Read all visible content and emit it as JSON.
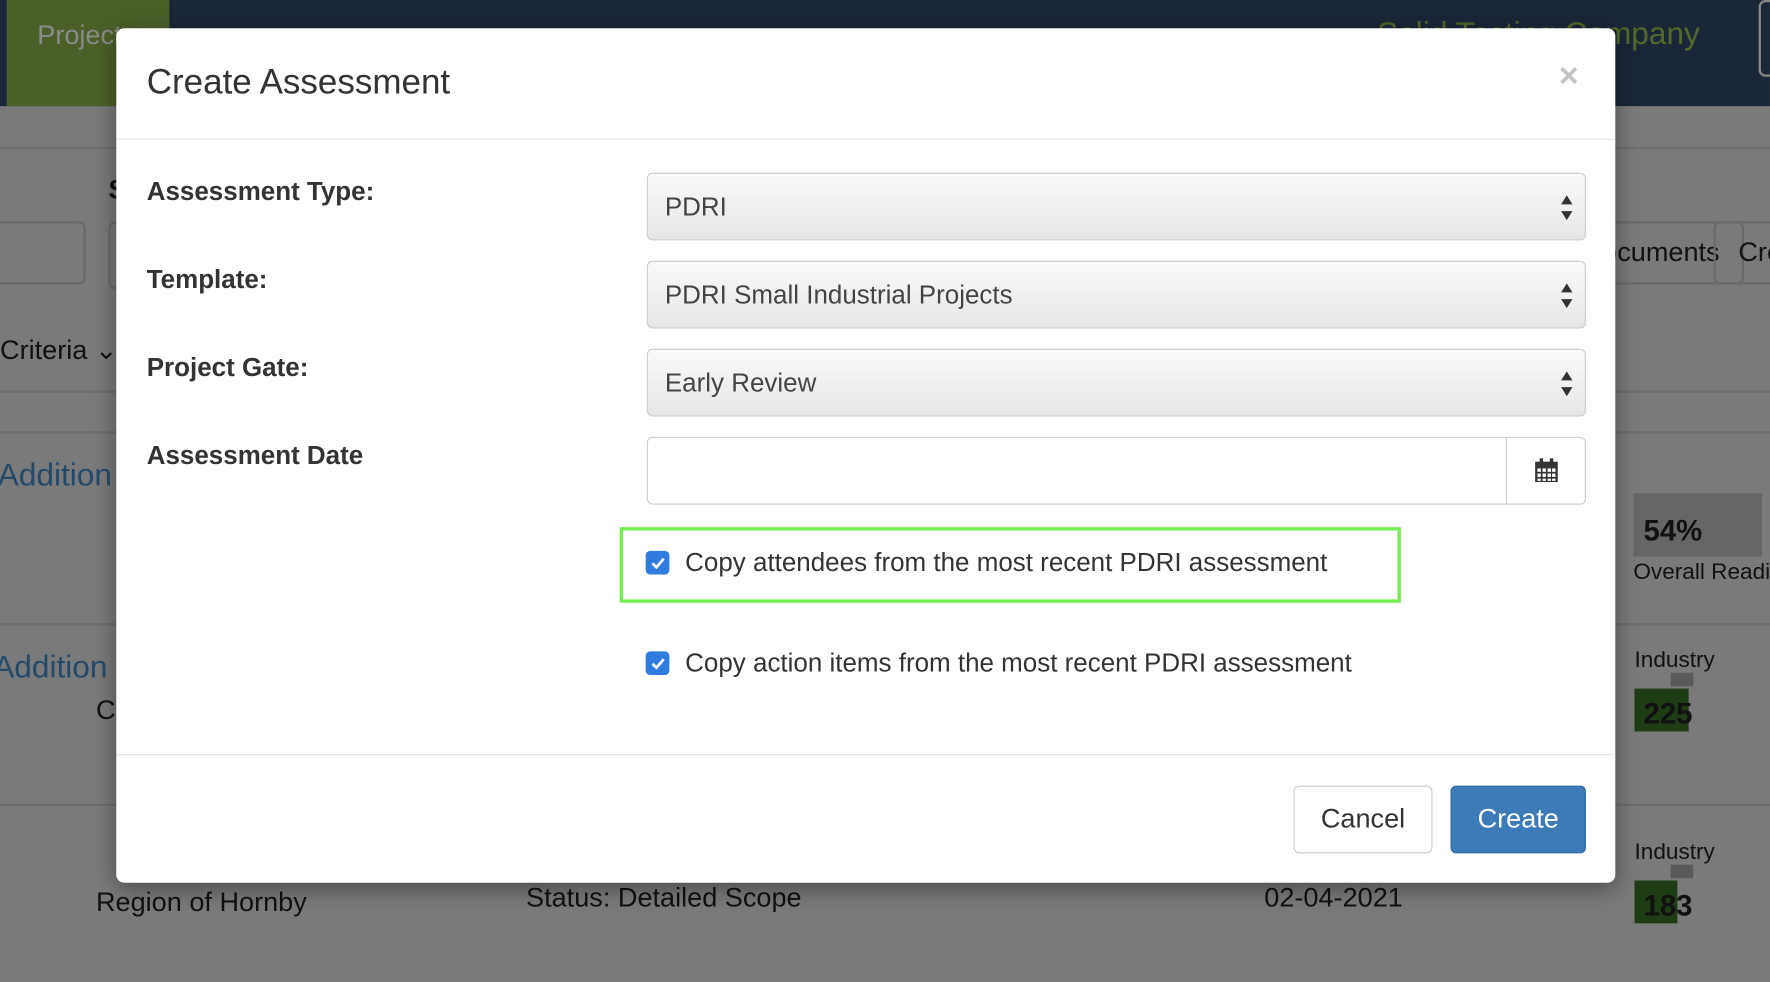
{
  "nav": {
    "active_tab": "Projects",
    "company": "Solid Testing Company"
  },
  "background": {
    "criteria_label": "Criteria",
    "link_1": "Addition",
    "link_2": "Addition",
    "row2_fragment": "C",
    "button_1": "Documents",
    "button_2": "Create",
    "overall_pct": "54%",
    "overall_label": "Overall Readiness",
    "industry_label_1": "Industry",
    "industry_value_1": "225",
    "industry_label_2": "Industry",
    "industry_value_2": "183",
    "row3_region": "Region of Hornby",
    "row3_status": "Status: Detailed Scope",
    "row3_date": "02-04-2021",
    "colors": {
      "industry_bar": "#1f3d14",
      "nav": "#1a2738",
      "nav_active": "#4b6028"
    }
  },
  "modal": {
    "title": "Create Assessment",
    "close_icon": "times-icon",
    "fields": {
      "assessment_type": {
        "label": "Assessment Type:",
        "value": "PDRI"
      },
      "template": {
        "label": "Template:",
        "value": "PDRI Small Industrial Projects"
      },
      "project_gate": {
        "label": "Project Gate:",
        "value": "Early Review"
      },
      "assessment_date": {
        "label": "Assessment Date",
        "value": "",
        "icon": "calendar-icon"
      }
    },
    "checkboxes": [
      {
        "label": "Copy attendees from the most recent PDRI assessment",
        "checked": true
      },
      {
        "label": "Copy action items from the most recent PDRI assessment",
        "checked": true
      }
    ],
    "cancel_label": "Cancel",
    "create_label": "Create",
    "colors": {
      "primary": "#3d7ab8",
      "highlight": "#72f050",
      "checkbox": "#2f7be0"
    }
  }
}
